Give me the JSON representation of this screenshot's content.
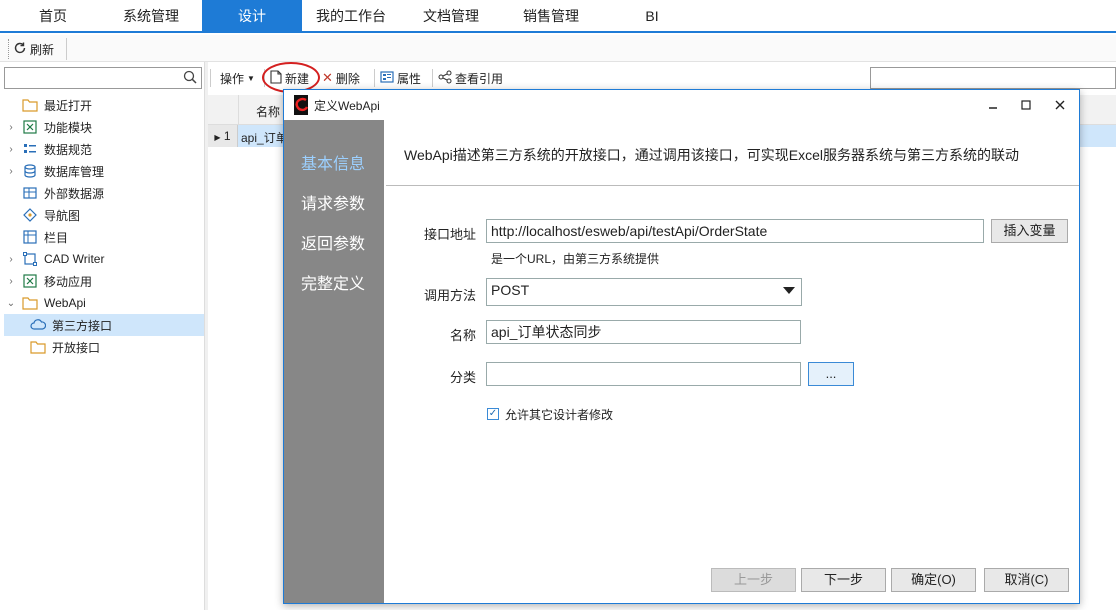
{
  "menubar": {
    "items": [
      "首页",
      "系统管理",
      "设计",
      "我的工作台",
      "文档管理",
      "销售管理",
      "BI"
    ],
    "active_index": 2
  },
  "toolbar": {
    "refresh_label": "刷新"
  },
  "left_panel": {
    "search_placeholder": "",
    "tree": [
      {
        "label": "最近打开",
        "icon": "folder-icon",
        "expandable": false,
        "indent": 0
      },
      {
        "label": "功能模块",
        "icon": "excel-icon",
        "expandable": true,
        "indent": 0
      },
      {
        "label": "数据规范",
        "icon": "list-icon",
        "expandable": true,
        "indent": 0
      },
      {
        "label": "数据库管理",
        "icon": "database-icon",
        "expandable": true,
        "indent": 0
      },
      {
        "label": "外部数据源",
        "icon": "datasource-icon",
        "expandable": false,
        "indent": 0
      },
      {
        "label": "导航图",
        "icon": "navigation-icon",
        "expandable": false,
        "indent": 0
      },
      {
        "label": "栏目",
        "icon": "column-icon",
        "expandable": false,
        "indent": 0
      },
      {
        "label": "CAD Writer",
        "icon": "cad-icon",
        "expandable": true,
        "indent": 0
      },
      {
        "label": "移动应用",
        "icon": "excel-icon",
        "expandable": true,
        "indent": 0
      },
      {
        "label": "WebApi",
        "icon": "folder-icon",
        "expandable": true,
        "expanded": true,
        "indent": 0
      },
      {
        "label": "第三方接口",
        "icon": "cloud-api-icon",
        "expandable": false,
        "indent": 1,
        "selected": true
      },
      {
        "label": "开放接口",
        "icon": "folder-icon",
        "expandable": false,
        "indent": 1
      }
    ]
  },
  "actions": {
    "operate": "操作",
    "new": "新建",
    "delete": "删除",
    "properties": "属性",
    "view_refs": "查看引用"
  },
  "grid": {
    "header_name": "名称",
    "row_index": "1",
    "row_value": "api_订单"
  },
  "dialog": {
    "title": "定义WebApi",
    "side_items": [
      "基本信息",
      "请求参数",
      "返回参数",
      "完整定义"
    ],
    "active_side": 0,
    "description": "WebApi描述第三方系统的开放接口，通过调用该接口，可实现Excel服务器系统与第三方系统的联动",
    "url_label": "接口地址",
    "url_value": "http://localhost/esweb/api/testApi/OrderState",
    "insert_var": "插入变量",
    "url_hint": "是一个URL，由第三方系统提供",
    "method_label": "调用方法",
    "method_value": "POST",
    "name_label": "名称",
    "name_value": "api_订单状态同步",
    "category_label": "分类",
    "category_value": "",
    "browse_btn": "...",
    "allow_modify": "允许其它设计者修改",
    "allow_modify_checked": true,
    "btn_prev": "上一步",
    "btn_next": "下一步",
    "btn_ok": "确定(O)",
    "btn_cancel": "取消(C)"
  },
  "colors": {
    "accent": "#1e7bd6",
    "sidebar_gray": "#878787",
    "side_active": "#9cd0ff",
    "selection": "#cfe6fb",
    "highlight_circle": "#d42020"
  }
}
